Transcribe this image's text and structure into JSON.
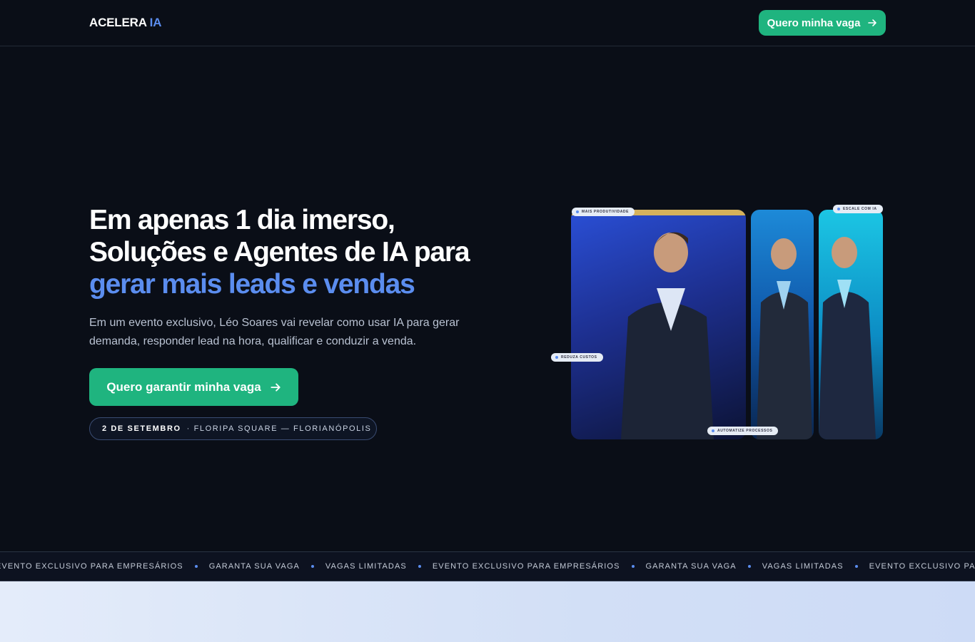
{
  "nav": {
    "logo_main": "ACELERA",
    "logo_accent": "IA",
    "cta_label": "Quero minha vaga"
  },
  "hero": {
    "title_line1": "Em apenas 1 dia imerso,",
    "title_line2": "Soluções e Agentes de IA para",
    "title_line3": "gerar mais leads e vendas",
    "subtitle": "Em um evento exclusivo, Léo Soares vai revelar como usar IA para gerar demanda, responder lead na hora, qualificar e conduzir a venda.",
    "cta_label": "Quero garantir minha vaga",
    "badge_date": "2 DE SETEMBRO",
    "badge_location": "· FLORIPA SQUARE — FLORIANÓPOLIS"
  },
  "photo_tags": [
    "MAIS PRODUTIVIDADE",
    "ESCALE COM IA",
    "REDUZA CUSTOS",
    "AUTOMATIZE PROCESSOS"
  ],
  "ticker": [
    "EVENTO EXCLUSIVO PARA EMPRESÁRIOS",
    "GARANTA SUA VAGA",
    "VAGAS LIMITADAS",
    "EVENTO EXCLUSIVO PARA EMPRESÁRIOS",
    "GARANTA SUA VAGA",
    "VAGAS LIMITADAS",
    "EVENTO EXCLUSIVO PARA EMPRESÁRIOS"
  ],
  "icons": {
    "arrow": "arrow-right-icon"
  },
  "colors": {
    "accent_blue": "#5b8def",
    "cta_green": "#1fb47f",
    "background": "#0a0e17"
  }
}
